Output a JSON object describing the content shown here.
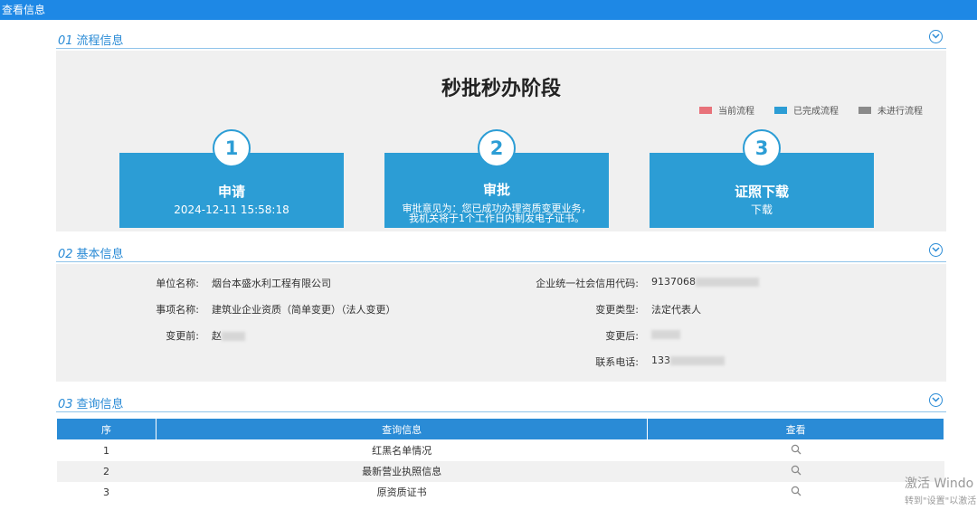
{
  "window": {
    "title": "查看信息"
  },
  "sections": {
    "process": {
      "num": "01",
      "title": "流程信息"
    },
    "basic": {
      "num": "02",
      "title": "基本信息"
    },
    "query": {
      "num": "03",
      "title": "查询信息"
    }
  },
  "process": {
    "stage_title": "秒批秒办阶段",
    "legend": [
      {
        "label": "当前流程",
        "color": "#e8727a"
      },
      {
        "label": "已完成流程",
        "color": "#2c9dd5"
      },
      {
        "label": "未进行流程",
        "color": "#8a8a8a"
      }
    ],
    "steps": [
      {
        "num": "1",
        "name": "申请",
        "sub": "2024-12-11 15:58:18"
      },
      {
        "num": "2",
        "name": "审批",
        "sub": "审批意见为：您已成功办理资质变更业务，我机关将于1个工作日内制发电子证书。"
      },
      {
        "num": "3",
        "name": "证照下载",
        "sub": "下载"
      }
    ]
  },
  "basic": {
    "unit_name_label": "单位名称:",
    "unit_name": "烟台本盛水利工程有限公司",
    "credit_code_label": "企业统一社会信用代码:",
    "credit_code": "9137068",
    "item_name_label": "事项名称:",
    "item_name": "建筑业企业资质（简单变更）（法人变更）",
    "change_type_label": "变更类型:",
    "change_type": "法定代表人",
    "before_label": "变更前:",
    "before_value": "赵",
    "after_label": "变更后:",
    "phone_label": "联系电话:",
    "phone": "133"
  },
  "query_table": {
    "headers": [
      "序",
      "查询信息",
      "查看"
    ],
    "rows": [
      {
        "index": "1",
        "info": "红黑名单情况"
      },
      {
        "index": "2",
        "info": "最新营业执照信息"
      },
      {
        "index": "3",
        "info": "原资质证书"
      }
    ]
  },
  "watermark": {
    "line1": "激活 Windo",
    "line2": "转到\"设置\"以激活"
  },
  "icons": {
    "collapse": "chevron-down-circle-icon",
    "view": "search-icon"
  }
}
